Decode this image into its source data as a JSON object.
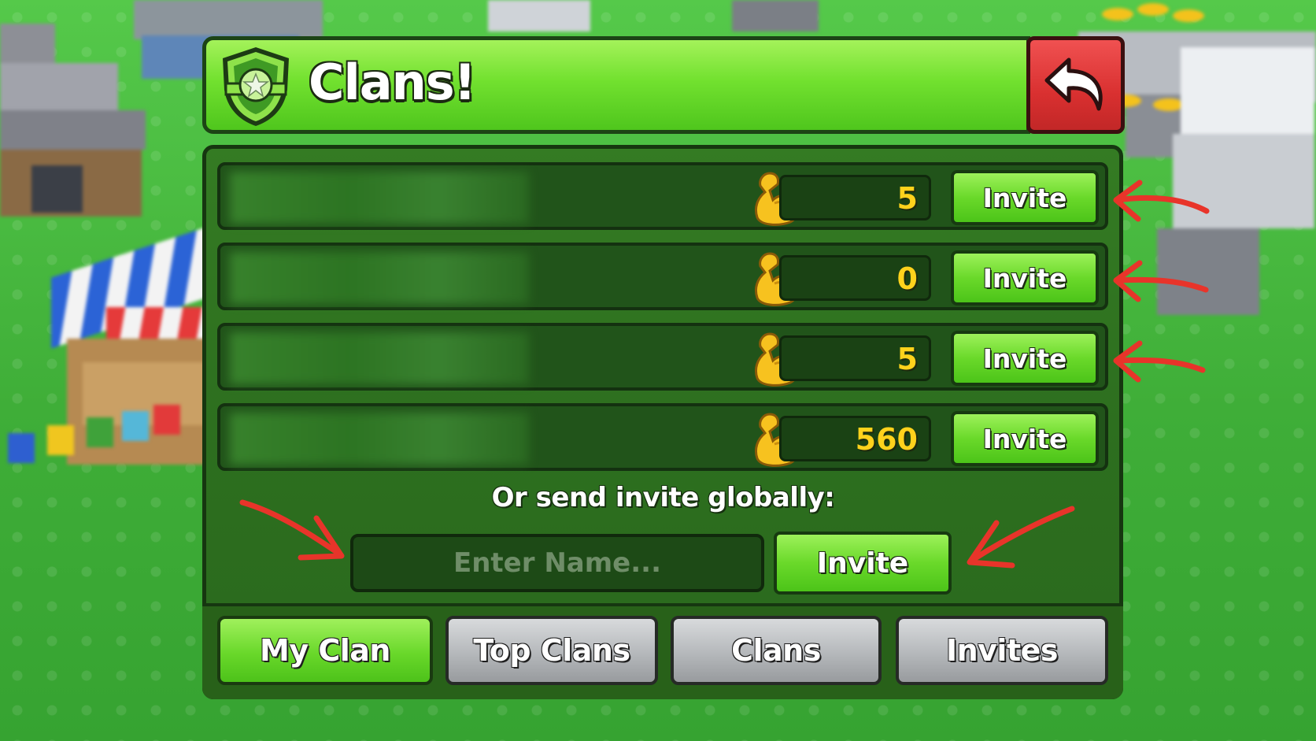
{
  "header": {
    "title": "Clans!",
    "back_icon": "back-arrow-icon",
    "shield_icon": "clan-shield-icon"
  },
  "rows": [
    {
      "value": "5",
      "invite_label": "Invite",
      "icon": "flexed-biceps-icon"
    },
    {
      "value": "0",
      "invite_label": "Invite",
      "icon": "flexed-biceps-icon"
    },
    {
      "value": "5",
      "invite_label": "Invite",
      "icon": "flexed-biceps-icon"
    },
    {
      "value": "560",
      "invite_label": "Invite",
      "icon": "flexed-biceps-icon"
    }
  ],
  "global": {
    "label": "Or send invite globally:",
    "input_placeholder": "Enter Name...",
    "input_value": "",
    "invite_label": "Invite"
  },
  "tabs": [
    {
      "label": "My Clan",
      "active": true
    },
    {
      "label": "Top Clans",
      "active": false
    },
    {
      "label": "Clans",
      "active": false
    },
    {
      "label": "Invites",
      "active": false
    }
  ],
  "colors": {
    "accent_green": "#6ad92a",
    "panel_green": "#2d6f1f",
    "back_red": "#d93030",
    "value_yellow": "#ffd21c",
    "annotation_red": "#e8342a"
  }
}
